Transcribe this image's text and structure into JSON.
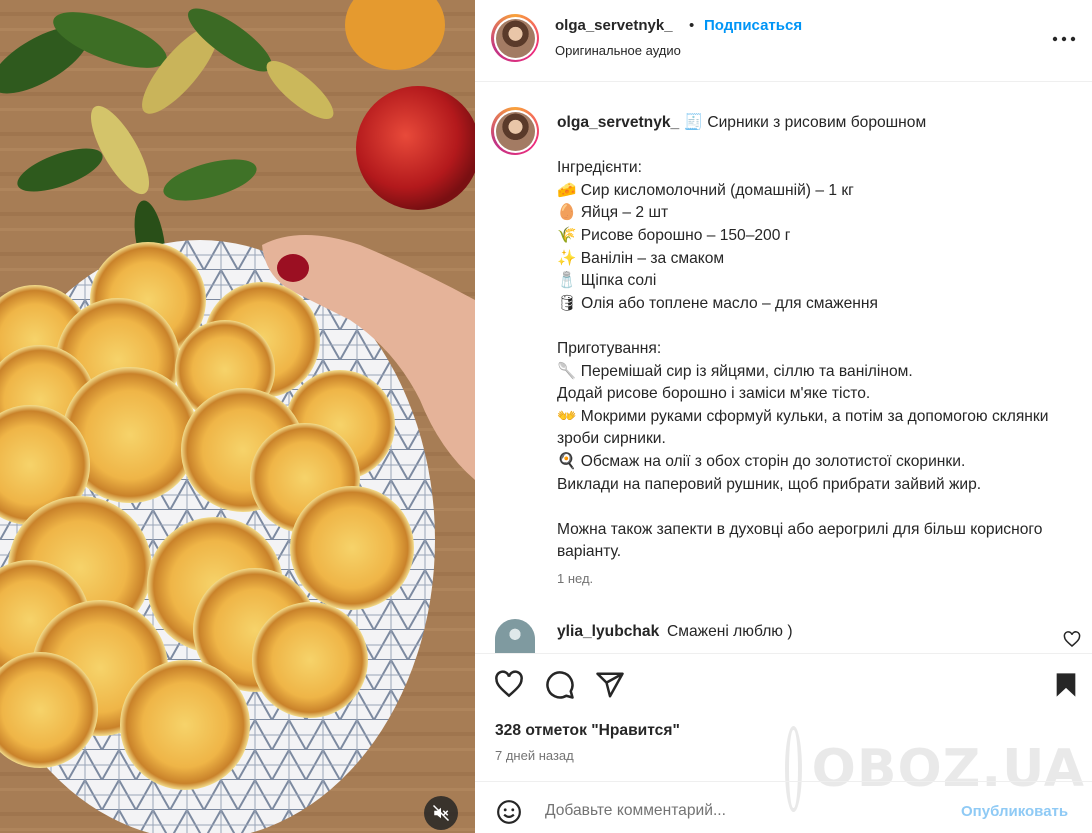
{
  "post": {
    "username": "olga_servetnyk_",
    "follow_label": "Подписаться",
    "separator": "•",
    "audio_label": "Оригинальное аудио"
  },
  "caption": {
    "username": "olga_servetnyk_",
    "text": "🧾 Сирники з рисовим борошном\n\nІнгредієнти:\n🧀 Сир кисломолочний (домашній) – 1 кг\n🥚 Яйця – 2 шт\n🌾 Рисове борошно – 150–200 г\n✨ Ванілін – за смаком\n🧂 Щіпка солі\n🛢 Олія або топлене масло – для смаження\n\nПриготування:\n🥄 Перемішай сир із яйцями, сіллю та ваніліном.\nДодай рисове борошно і заміси м'яке тісто.\n👐 Мокрими руками сформуй кульки, а потім за допомогою склянки зроби сирники.\n🍳 Обсмаж на олії з обох сторін до золотистої скоринки.\nВиклади на паперовий рушник, щоб прибрати зайвий жир.\n\nМожна також запекти в духовці або аерогрилі для більш корисного варіанту.",
    "time": "1 нед."
  },
  "comment": {
    "username": "ylia_lyubchak",
    "text": "Смажені люблю )"
  },
  "stats": {
    "likes": "328 отметок \"Нравится\"",
    "posted_ago": "7 дней назад"
  },
  "add_comment": {
    "placeholder": "Добавьте комментарий...",
    "publish_label": "Опубликовать"
  },
  "watermark": {
    "text": "OBOZ.UA"
  },
  "icons": {
    "more": "more-options-icon",
    "like": "heart-icon",
    "comment": "comment-icon",
    "share": "share-icon",
    "save": "bookmark-icon",
    "emoji": "emoji-icon",
    "mute": "muted-speaker-icon"
  },
  "colors": {
    "link": "#0095f6",
    "publish_disabled": "#8fcaf5",
    "secondary_text": "#737373",
    "divider": "#efefef"
  }
}
